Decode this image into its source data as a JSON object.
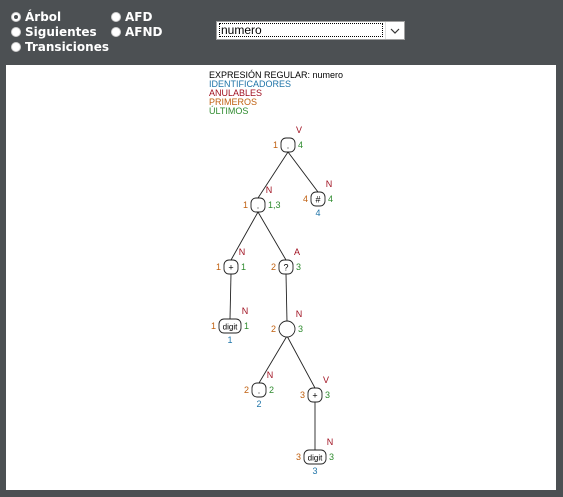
{
  "options": {
    "arbol": "Árbol",
    "siguientes": "Siguientes",
    "transiciones": "Transiciones",
    "afd": "AFD",
    "afnd": "AFND"
  },
  "select": {
    "value": "numero"
  },
  "legend": {
    "expresion_label": "EXPRESIÓN REGULAR:",
    "expresion_value": "numero",
    "identificadores": "IDENTIFICADORES",
    "anulables": "ANULABLES",
    "primeros": "PRIMEROS",
    "ultimos": "ÚLTIMOS"
  },
  "colors": {
    "identificadores": "#1f74a8",
    "anulables": "#a01020",
    "primeros": "#c06010",
    "ultimos": "#2e8b2e",
    "background": "#4c5053"
  },
  "tree": {
    "nodes": [
      {
        "id": "n1",
        "label": ".",
        "anulable": "V",
        "primeros": "1",
        "ultimos": "4",
        "identificador": ""
      },
      {
        "id": "n2",
        "label": ".",
        "anulable": "N",
        "primeros": "1",
        "ultimos": "1,3",
        "identificador": ""
      },
      {
        "id": "n3",
        "label": "#",
        "anulable": "N",
        "primeros": "4",
        "ultimos": "4",
        "identificador": "4"
      },
      {
        "id": "n4",
        "label": "+",
        "anulable": "N",
        "primeros": "1",
        "ultimos": "1",
        "identificador": ""
      },
      {
        "id": "n5",
        "label": "?",
        "anulable": "A",
        "primeros": "2",
        "ultimos": "3",
        "identificador": ""
      },
      {
        "id": "n6",
        "label": "digit",
        "anulable": "N",
        "primeros": "1",
        "ultimos": "1",
        "identificador": "1"
      },
      {
        "id": "n7",
        "label": "",
        "anulable": "N",
        "primeros": "2",
        "ultimos": "3",
        "identificador": ""
      },
      {
        "id": "n8",
        "label": ".",
        "anulable": "N",
        "primeros": "2",
        "ultimos": "2",
        "identificador": "2"
      },
      {
        "id": "n9",
        "label": "+",
        "anulable": "V",
        "primeros": "3",
        "ultimos": "3",
        "identificador": ""
      },
      {
        "id": "n10",
        "label": "digit",
        "anulable": "N",
        "primeros": "3",
        "ultimos": "3",
        "identificador": "3"
      }
    ],
    "edges": [
      [
        "n1",
        "n2"
      ],
      [
        "n1",
        "n3"
      ],
      [
        "n2",
        "n4"
      ],
      [
        "n2",
        "n5"
      ],
      [
        "n4",
        "n6"
      ],
      [
        "n5",
        "n7"
      ],
      [
        "n7",
        "n8"
      ],
      [
        "n7",
        "n9"
      ],
      [
        "n9",
        "n10"
      ]
    ]
  }
}
